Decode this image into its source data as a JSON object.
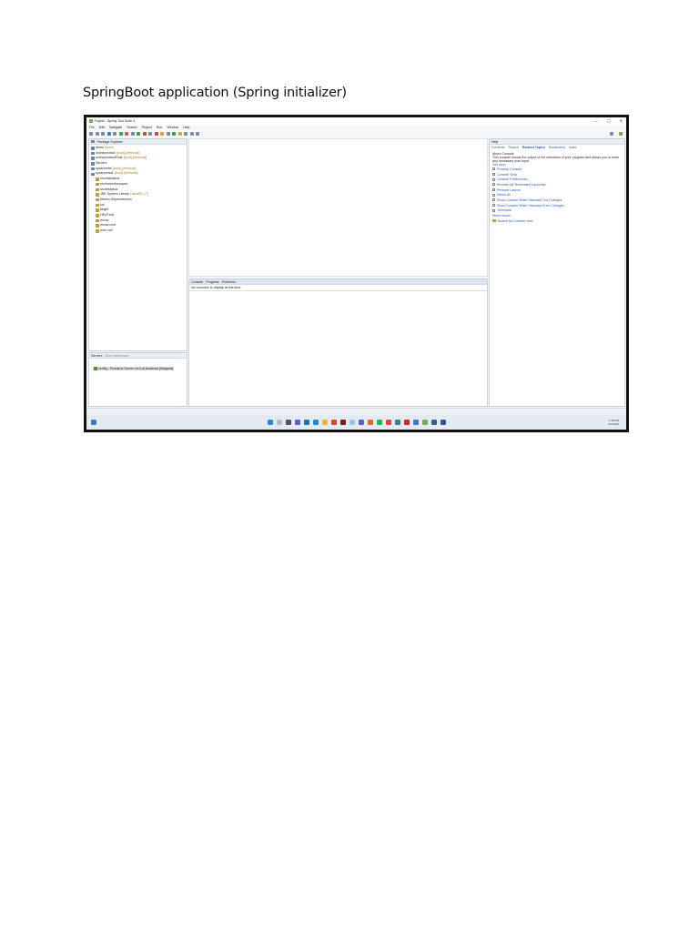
{
  "heading": "SpringBoot application (Spring initializer)",
  "ide": {
    "title": "Project - Spring Tool Suite 4",
    "window_buttons": [
      "—",
      "▢",
      "✕"
    ],
    "menu": [
      "File",
      "Edit",
      "Navigate",
      "Search",
      "Project",
      "Run",
      "Window",
      "Help"
    ],
    "package_explorer": {
      "tab": "Package Explorer",
      "items": [
        {
          "name": "demo",
          "dec": "[boot]"
        },
        {
          "name": "onlineproduct",
          "dec": "[boot] [devtools]"
        },
        {
          "name": "onlineproductFinal",
          "dec": "[boot] [devtools]"
        },
        {
          "name": "Servers",
          "dec": ""
        },
        {
          "name": "sycarportal",
          "dec": "[boot] [devtools]"
        },
        {
          "name": "sycarportal1",
          "dec": "[boot] [devtools]"
        },
        {
          "name": "src/main/java",
          "dec": ""
        },
        {
          "name": "src/main/resources",
          "dec": ""
        },
        {
          "name": "src/test/java",
          "dec": ""
        },
        {
          "name": "JRE System Library",
          "dec": "[JavaSE-17]"
        },
        {
          "name": "Maven Dependencies",
          "dec": ""
        },
        {
          "name": "src",
          "dec": ""
        },
        {
          "name": "target",
          "dec": ""
        },
        {
          "name": "HELP.md",
          "dec": ""
        },
        {
          "name": "mvnw",
          "dec": ""
        },
        {
          "name": "mvnw.cmd",
          "dec": ""
        },
        {
          "name": "pom.xml",
          "dec": ""
        }
      ]
    },
    "servers": {
      "tab": "Servers",
      "tab2": "Boot Dashboard",
      "entry": "config - Pivotal tc Server v4.0 at localhost [Stopped]"
    },
    "console": {
      "tabs": [
        "Console",
        "Progress",
        "Problems"
      ],
      "message": "No consoles to display at this time."
    },
    "help": {
      "tab": "Help",
      "nav": [
        "Contents",
        "Search",
        "Related Topics",
        "Bookmarks",
        "Index"
      ],
      "about_title": "About Console",
      "about_text": "This console shows the output of the execution of your program and allows you to enter any necessary user input.",
      "see_also": "See also:",
      "links": [
        "Process Console",
        "Console View",
        "Console Preferences",
        "Remove All Terminated Launches",
        "Remove Launch",
        "Select All",
        "Show Console When Standard Out Changes",
        "Show Console When Standard Error Changes",
        "Terminate"
      ],
      "more": "More results",
      "search": "Search for Console view"
    },
    "clock": {
      "time": "1:36 PM",
      "date": "3/7/2023"
    }
  }
}
